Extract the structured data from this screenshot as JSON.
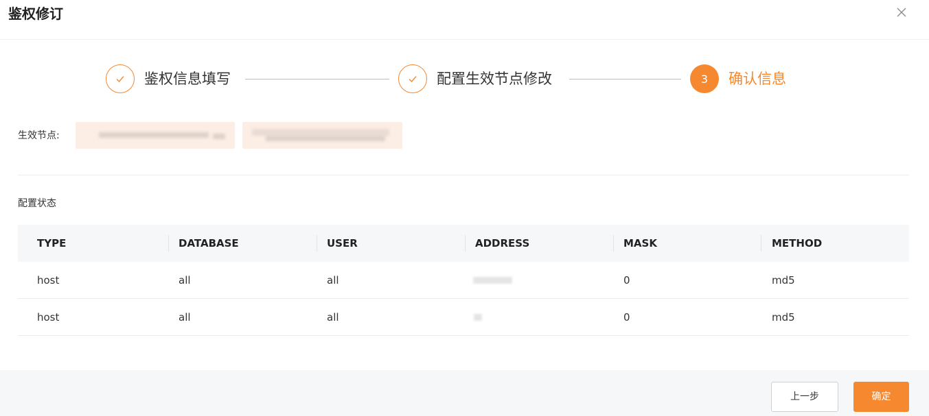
{
  "dialog": {
    "title": "鉴权修订"
  },
  "steps": [
    {
      "label": "鉴权信息填写",
      "status": "done"
    },
    {
      "label": "配置生效节点修改",
      "status": "done"
    },
    {
      "label": "确认信息",
      "status": "active",
      "number": "3"
    }
  ],
  "nodes": {
    "label": "生效节点:"
  },
  "config": {
    "section_title": "配置状态",
    "columns": [
      "TYPE",
      "DATABASE",
      "USER",
      "ADDRESS",
      "MASK",
      "METHOD"
    ],
    "rows": [
      {
        "type": "host",
        "database": "all",
        "user": "all",
        "mask": "0",
        "method": "md5"
      },
      {
        "type": "host",
        "database": "all",
        "user": "all",
        "mask": "0",
        "method": "md5"
      }
    ]
  },
  "footer": {
    "prev_label": "上一步",
    "confirm_label": "确定"
  },
  "colors": {
    "accent": "#f6882f",
    "chip_bg": "#fdeee5",
    "header_bg": "#f6f7f9"
  },
  "icons": {
    "close": "close-icon",
    "done_step": "check-icon"
  }
}
